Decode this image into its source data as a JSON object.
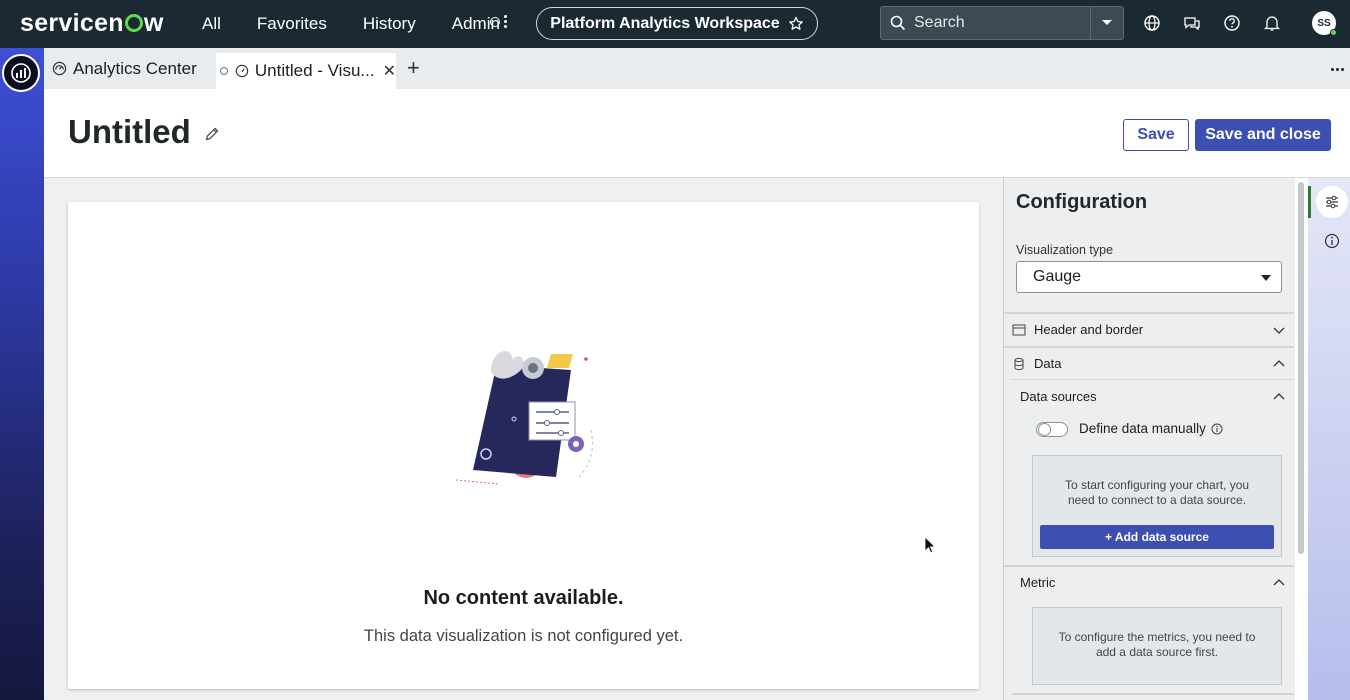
{
  "topnav": {
    "brand": "servicenow",
    "links": [
      "All",
      "Favorites",
      "History",
      "Admin"
    ],
    "workspace_pill": "Platform Analytics Workspace",
    "search_placeholder": "Search",
    "avatar_initials": "SS"
  },
  "tabs": {
    "home_label": "Analytics Center",
    "active_label": "Untitled - Visu...",
    "add_label": "+"
  },
  "page": {
    "title": "Untitled",
    "save_label": "Save",
    "save_close_label": "Save and close"
  },
  "canvas": {
    "empty_title": "No content available.",
    "empty_subtitle": "This data visualization is not configured yet."
  },
  "config": {
    "title": "Configuration",
    "viz_type_label": "Visualization type",
    "viz_type_value": "Gauge",
    "sections": {
      "header_border": "Header and border",
      "data": "Data",
      "data_sources": "Data sources",
      "metric": "Metric"
    },
    "define_manually_label": "Define data manually",
    "data_source_hint": "To start configuring your chart, you need to connect to a data source.",
    "add_data_source_label": "+ Add data source",
    "metric_hint": "To configure the metrics, you need to add a data source first."
  },
  "colors": {
    "nav_bg": "#1b2a32",
    "primary": "#3e4fb2",
    "brand_green": "#62d84e"
  }
}
